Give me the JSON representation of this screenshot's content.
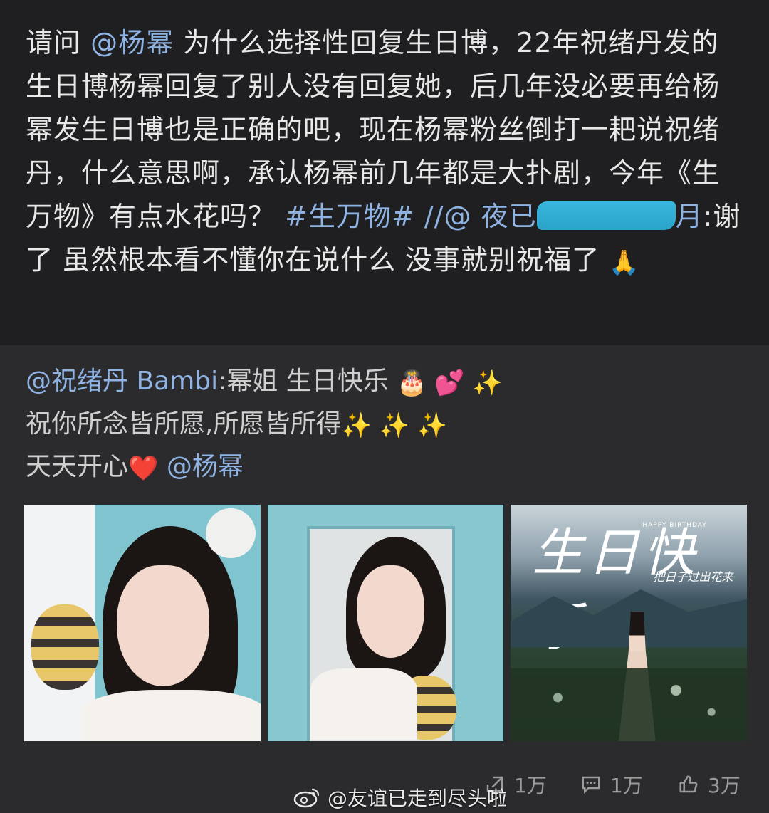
{
  "post": {
    "segments": {
      "s1": "请问",
      "s2": "@杨幂",
      "s3": "为什么选择性回复生日博，22年祝绪丹发的生日博杨幂回复了别人没有回复她，后几年没必要再给杨幂发生日博也是正确的吧，现在杨幂粉丝倒打一耙说祝绪丹，什么意思啊，承认杨幂前几年都是大扑剧，今年《生万物》有点水花吗？",
      "s4": "#生万物#",
      "s5": "//@",
      "s6": "夜已",
      "s7": "月",
      "s8": ":谢了 虽然根本看不懂你在说什么 没事就别祝福了"
    },
    "emoji": "🙏"
  },
  "quote": {
    "line1_user": "@祝绪丹 Bambi",
    "line1_text": ":幂姐 生日快乐",
    "line1_emoji": "🎂 💕 ✨",
    "line2_text": "祝你所念皆所愿,所愿皆所得",
    "line2_emoji": "✨ ✨ ✨",
    "line3_text": "天天开心",
    "line3_emoji": "❤️",
    "line3_mention": "@杨幂"
  },
  "images": {
    "third_title": "生日快乐",
    "third_happy": "HAPPY BIRTHDAY",
    "third_sub": "把日子过出花来"
  },
  "stats": {
    "repost": "1万",
    "comment": "1万",
    "like": "3万"
  },
  "watermark": {
    "text": "@友谊已走到尽头啦"
  },
  "colors": {
    "background": "#1f1f21",
    "quote_background": "#2b2b2e",
    "link": "#8fb3e3",
    "redaction": "#2aa3c9"
  }
}
